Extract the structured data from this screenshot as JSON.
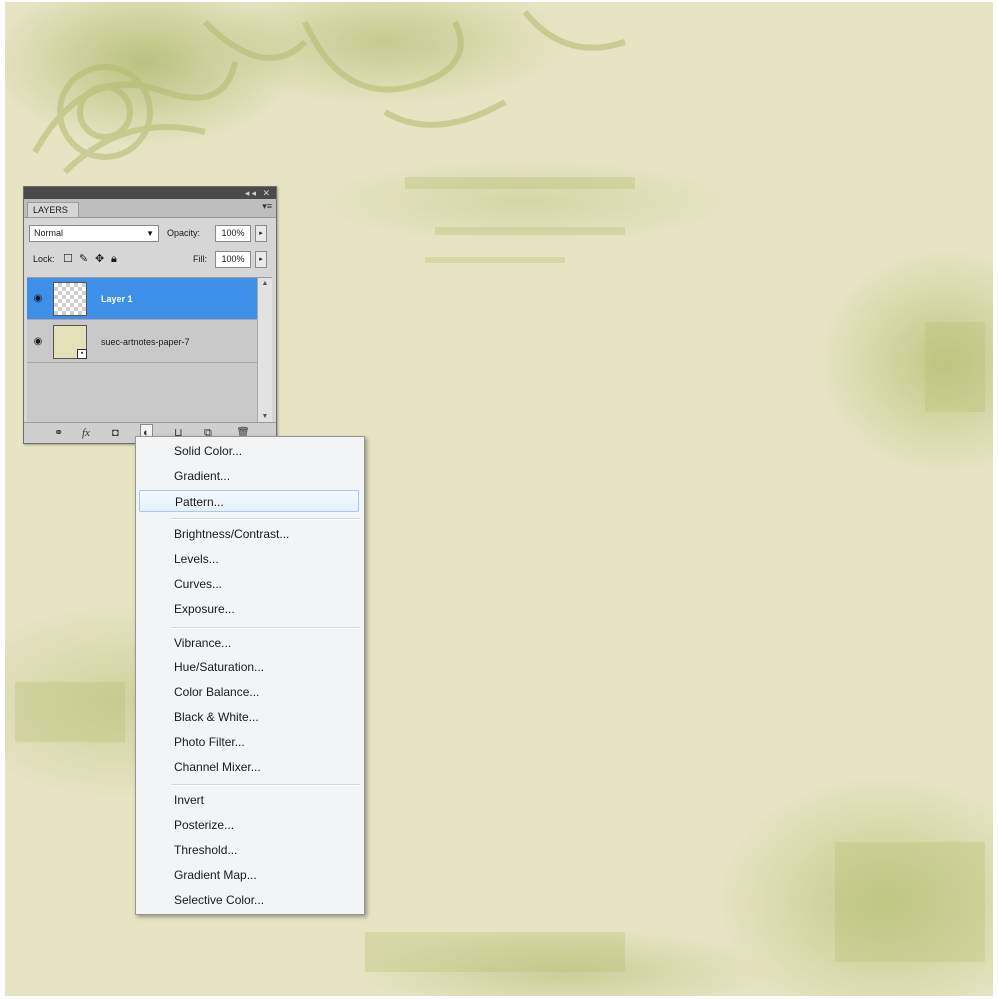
{
  "panel": {
    "tab_label": "LAYERS",
    "panel_menu_icon": "▾≡",
    "title_controls": "◂◂ ✕",
    "blend_mode": "Normal",
    "opacity_label": "Opacity:",
    "opacity_value": "100%",
    "lock_label": "Lock:",
    "fill_label": "Fill:",
    "fill_value": "100%"
  },
  "layers": [
    {
      "name": "Layer 1",
      "selected": true
    },
    {
      "name": "suec-artnotes-paper-7",
      "selected": false
    }
  ],
  "bottom_icons": [
    "link-icon",
    "fx-icon",
    "mask-icon",
    "adjustment-icon",
    "folder-icon",
    "new-layer-icon",
    "trash-icon"
  ],
  "menu": {
    "groups": [
      [
        "Solid Color...",
        "Gradient...",
        "Pattern..."
      ],
      [
        "Brightness/Contrast...",
        "Levels...",
        "Curves...",
        "Exposure..."
      ],
      [
        "Vibrance...",
        "Hue/Saturation...",
        "Color Balance...",
        "Black & White...",
        "Photo Filter...",
        "Channel Mixer..."
      ],
      [
        "Invert",
        "Posterize...",
        "Threshold...",
        "Gradient Map...",
        "Selective Color..."
      ]
    ],
    "hovered": "Pattern..."
  },
  "colors": {
    "selection": "#3d8fe8",
    "canvas": "#e6e4c3"
  }
}
